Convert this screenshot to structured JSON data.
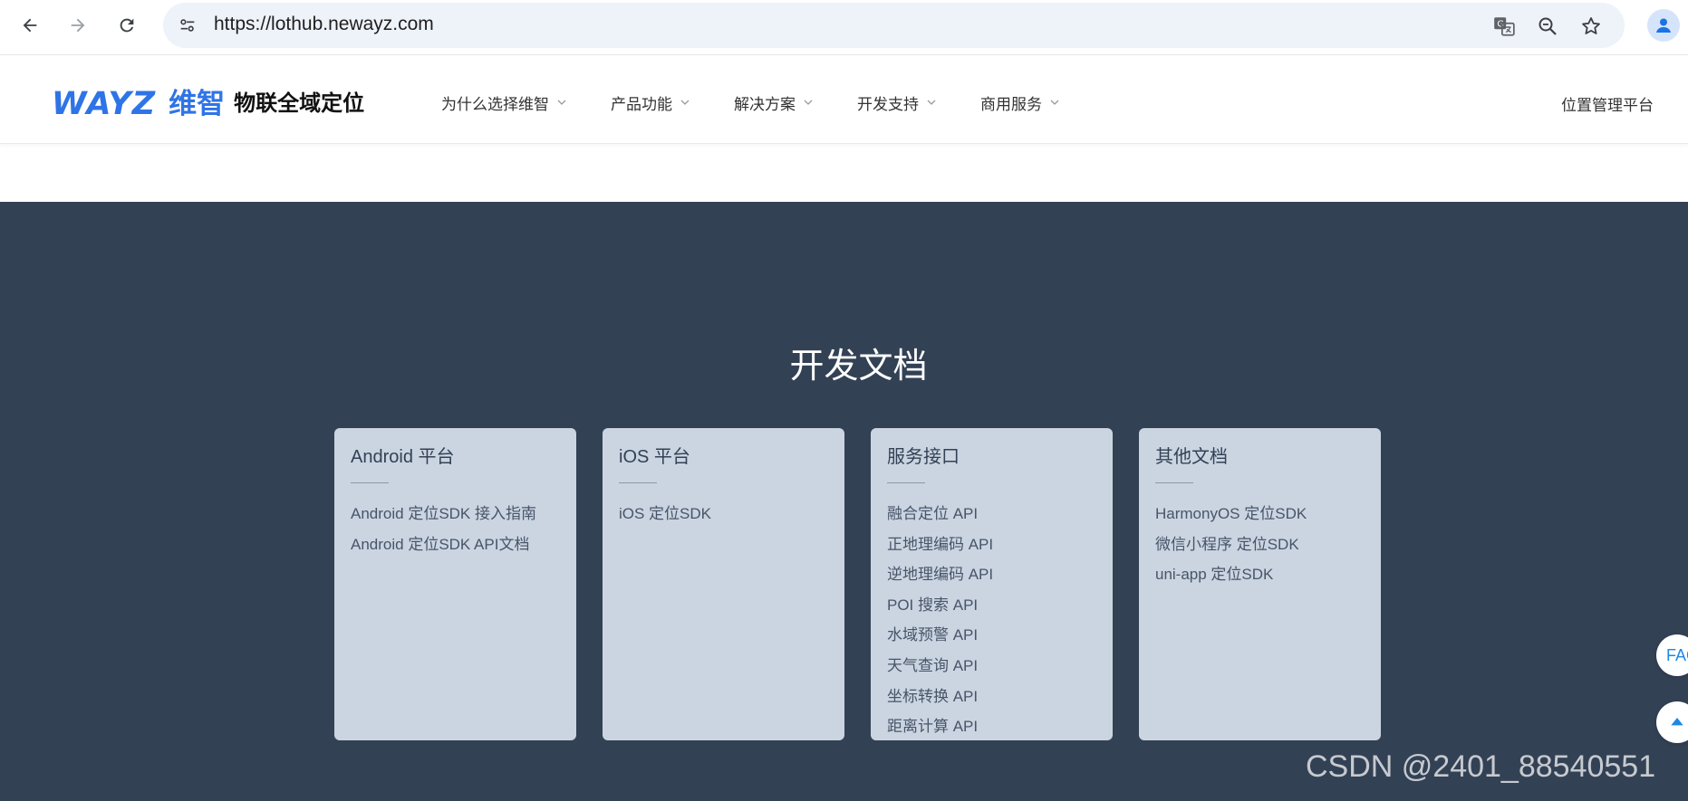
{
  "browser": {
    "url": "https://lothub.newayz.com"
  },
  "header": {
    "logo_text": "WAYZ",
    "logo_cn": "维智",
    "slogan": "物联全域定位",
    "nav": [
      {
        "label": "为什么选择维智"
      },
      {
        "label": "产品功能"
      },
      {
        "label": "解决方案"
      },
      {
        "label": "开发支持"
      },
      {
        "label": "商用服务"
      }
    ],
    "right_link": "位置管理平台"
  },
  "docs": {
    "title": "开发文档",
    "cards": [
      {
        "title": "Android 平台",
        "links": [
          "Android 定位SDK 接入指南",
          "Android 定位SDK API文档"
        ]
      },
      {
        "title": "iOS 平台",
        "links": [
          "iOS 定位SDK"
        ]
      },
      {
        "title": "服务接口",
        "links": [
          "融合定位 API",
          "正地理编码 API",
          "逆地理编码 API",
          "POI 搜索 API",
          "水域预警 API",
          "天气查询 API",
          "坐标转换 API",
          "距离计算 API"
        ]
      },
      {
        "title": "其他文档",
        "links": [
          "HarmonyOS 定位SDK",
          "微信小程序 定位SDK",
          "uni-app 定位SDK"
        ]
      }
    ]
  },
  "floating": {
    "faq_label": "FAQ"
  },
  "watermark": "CSDN @2401_88540551",
  "colors": {
    "brand_blue": "#2f74e6",
    "section_bg": "#334155",
    "card_bg": "#cbd5e1"
  }
}
